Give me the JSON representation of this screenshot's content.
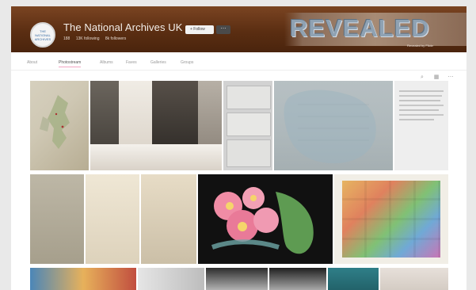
{
  "profile": {
    "avatar_text": "THE NATIONAL ARCHIVES",
    "title": "The National Archives UK",
    "meta": [
      "188",
      "13K following",
      "8k followers"
    ],
    "follow_label": "+ Follow",
    "more_label": "⋯",
    "cover_title": "REVEALED",
    "cover_caption": "Revealed by Flickr"
  },
  "tabs": [
    "About",
    "Photostream",
    "Albums",
    "Faves",
    "Galleries",
    "Groups"
  ],
  "active_tab_index": 1,
  "toolbar": {
    "search_icon": "search-icon",
    "grid_icon": "grid-icon",
    "more_icon": "ellipsis-icon"
  },
  "photos": [
    "map-of-british-isles",
    "sketch-of-village-street",
    "handwritten-document-cards",
    "county-map-blue",
    "typed-report-page",
    "old-document-1",
    "old-document-2",
    "old-document-3",
    "pink-flowers-illustration",
    "cigarette-card-collection",
    "poster-colorful",
    "engraved-illustration",
    "portrait-man-1",
    "portrait-man-2",
    "cnr-poster",
    "faded-print"
  ]
}
